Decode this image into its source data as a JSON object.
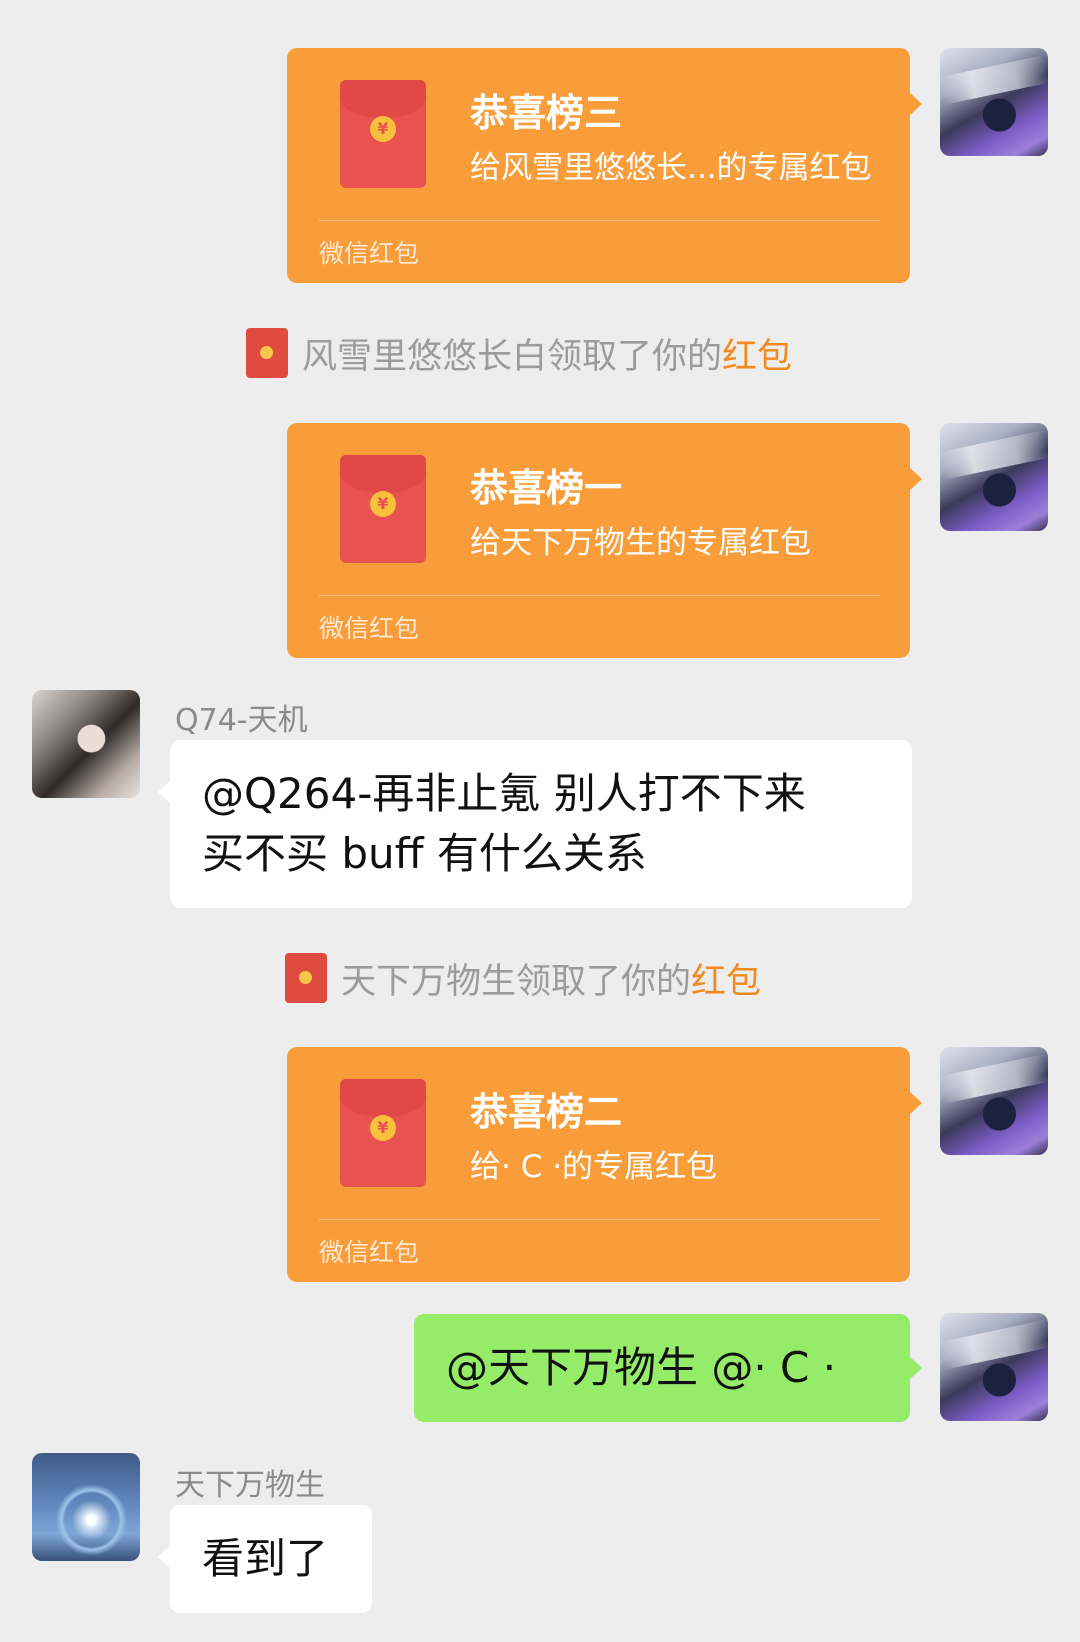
{
  "brand_label": "微信红包",
  "packets": [
    {
      "title": "恭喜榜三",
      "desc": "给风雪里悠悠长...的专属红包"
    },
    {
      "title": "恭喜榜一",
      "desc": "给天下万物生的专属红包"
    },
    {
      "title": "恭喜榜二",
      "desc": "给· C ·的专属红包"
    }
  ],
  "notices": [
    {
      "text": "风雪里悠悠长白领取了你的",
      "link": "红包"
    },
    {
      "text": "天下万物生领取了你的",
      "link": "红包"
    }
  ],
  "messages": [
    {
      "sender": "Q74-天机",
      "lines": [
        "@Q264-再非止氪  别人打不下来",
        "买不买 buff 有什么关系"
      ]
    },
    {
      "sender": "",
      "lines": [
        "@天下万物生  @· C ·"
      ]
    },
    {
      "sender": "天下万物生",
      "lines": [
        "看到了"
      ]
    }
  ],
  "colors": {
    "background": "#ededed",
    "packet": "#f89d3a",
    "self_bubble": "#95ec69",
    "notice_link": "#f28a1e"
  },
  "icons": {
    "packet": "red-packet-icon",
    "coin": "yuan-coin-icon"
  },
  "coin_glyph": "¥"
}
